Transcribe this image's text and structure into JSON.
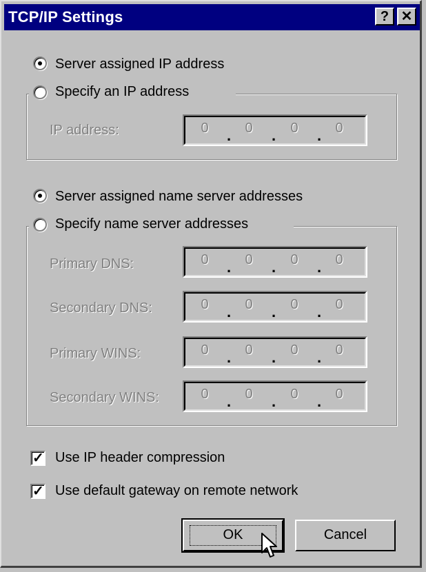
{
  "window": {
    "title": "TCP/IP Settings",
    "help_label": "?",
    "close_label": "✕"
  },
  "ip": {
    "radio_server": "Server assigned IP address",
    "radio_specify": "Specify an IP address",
    "selected": "server",
    "label": "IP address:",
    "octets": [
      "0",
      "0",
      "0",
      "0"
    ]
  },
  "dns": {
    "radio_server": "Server assigned name server addresses",
    "radio_specify": "Specify name server addresses",
    "selected": "server",
    "fields": [
      {
        "label": "Primary DNS:",
        "octets": [
          "0",
          "0",
          "0",
          "0"
        ]
      },
      {
        "label": "Secondary DNS:",
        "octets": [
          "0",
          "0",
          "0",
          "0"
        ]
      },
      {
        "label": "Primary WINS:",
        "octets": [
          "0",
          "0",
          "0",
          "0"
        ]
      },
      {
        "label": "Secondary WINS:",
        "octets": [
          "0",
          "0",
          "0",
          "0"
        ]
      }
    ]
  },
  "options": [
    {
      "label": "Use IP header compression",
      "checked": true
    },
    {
      "label": "Use default gateway on remote network",
      "checked": true
    }
  ],
  "buttons": {
    "ok": "OK",
    "cancel": "Cancel"
  },
  "icons": {
    "help": "question-mark-icon",
    "close": "close-icon",
    "cursor": "mouse-pointer-icon"
  }
}
